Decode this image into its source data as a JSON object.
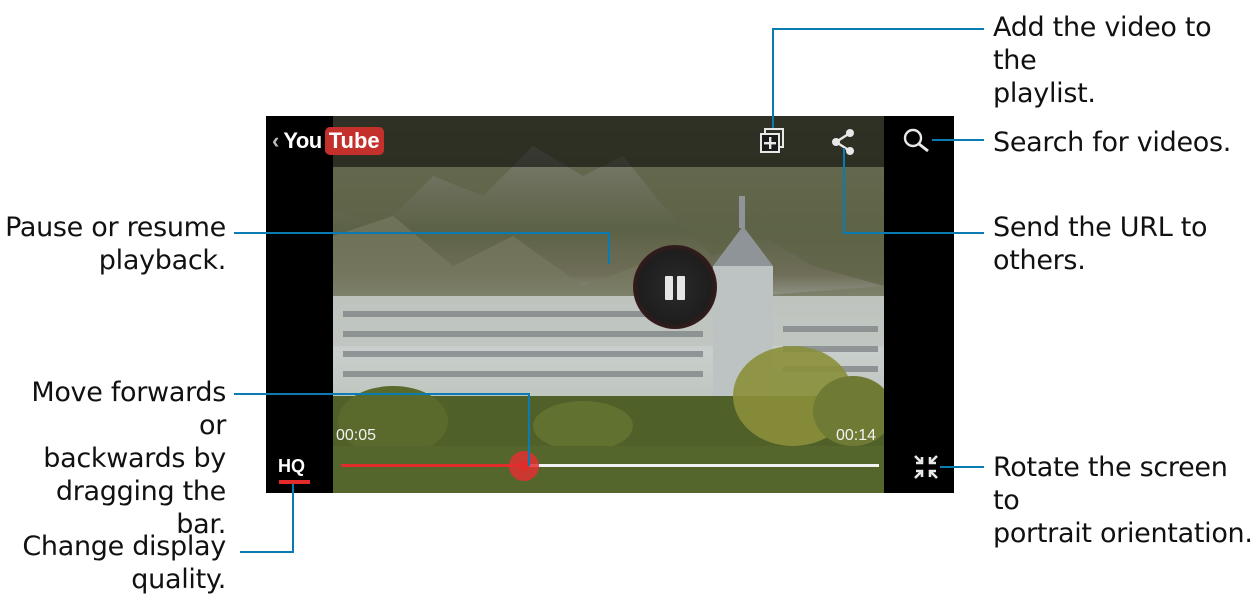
{
  "callouts": {
    "add_playlist": [
      "Add the video to the",
      "playlist."
    ],
    "search": "Search for videos.",
    "send_url": [
      "Send the URL to",
      "others."
    ],
    "rotate": [
      "Rotate the screen to",
      "portrait orientation."
    ],
    "pause": [
      "Pause or resume",
      "playback."
    ],
    "seek": [
      "Move forwards or",
      "backwards by",
      "dragging the bar."
    ],
    "quality": [
      "Change display",
      "quality."
    ]
  },
  "player": {
    "logo_back": "‹",
    "logo_you": "You",
    "logo_tube": "Tube",
    "time_elapsed": "00:05",
    "time_total": "00:14",
    "quality_label": "HQ",
    "progress_fraction": 0.34,
    "icons": [
      "add-to-playlist-icon",
      "share-icon",
      "search-icon",
      "pause-icon",
      "collapse-icon"
    ]
  },
  "colors": {
    "accent_red": "#e22b2b",
    "callout_line": "#0a7bb3",
    "youtube_red": "#c4302b"
  }
}
